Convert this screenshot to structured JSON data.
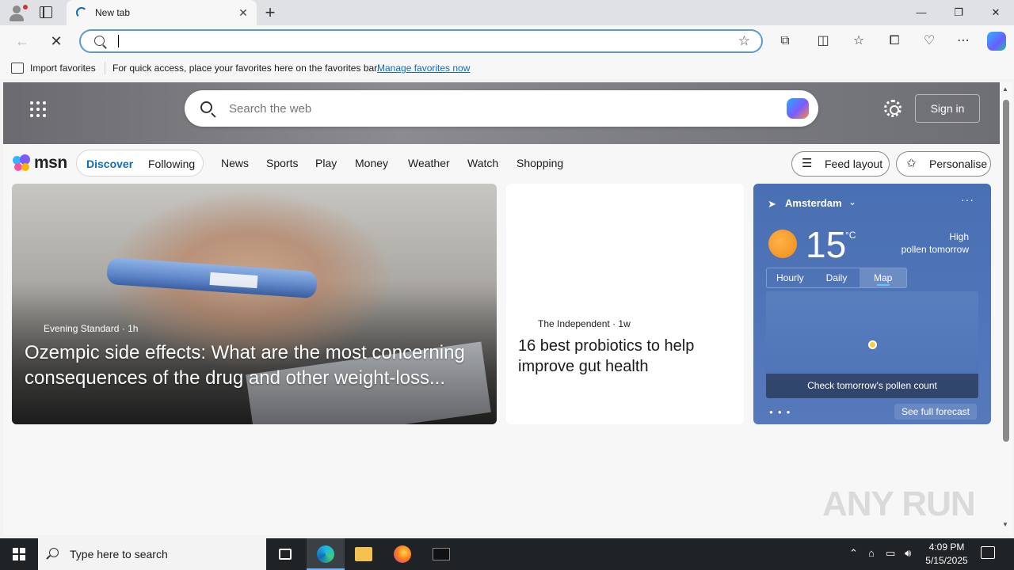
{
  "browser": {
    "tab": {
      "title": "New tab",
      "close": "✕"
    },
    "new_tab": "+",
    "window_controls": {
      "minimize": "—",
      "restore": "❐",
      "close": "✕"
    },
    "address": {
      "value": "",
      "placeholder": ""
    },
    "favorites_bar": {
      "import_label": "Import favorites",
      "message": "For quick access, place your favorites here on the favorites bar.",
      "manage_link": "Manage favorites now"
    },
    "toolbar_icons": [
      "extensions-icon",
      "split-screen-icon",
      "favorites-icon",
      "collections-icon",
      "browser-essentials-icon",
      "more-icon",
      "copilot-icon"
    ]
  },
  "msn": {
    "search_placeholder": "Search the web",
    "sign_in": "Sign in",
    "logo": "msn",
    "pill": {
      "discover": "Discover",
      "following": "Following"
    },
    "categories": [
      "News",
      "Sports",
      "Play",
      "Money",
      "Weather",
      "Watch",
      "Shopping"
    ],
    "feed_layout": "Feed layout",
    "personalise": "Personalise"
  },
  "cards": {
    "hero": {
      "source": "Evening Standard · 1h",
      "headline": "Ozempic side effects: What are the most concerning consequences of the drug and other weight-loss..."
    },
    "story": {
      "source": "The Independent · 1w",
      "headline": "16 best probiotics to help improve gut health"
    }
  },
  "weather": {
    "city": "Amsterdam",
    "temperature": "15",
    "unit": "°C",
    "alert_line1": "High",
    "alert_line2": "pollen tomorrow",
    "tabs": [
      "Hourly",
      "Daily",
      "Map"
    ],
    "active_tab": "Map",
    "map_cta": "Check tomorrow's pollen count",
    "see_full": "See full forecast",
    "more": "···",
    "dots": "●●●"
  },
  "watermark": "ANY RUN",
  "taskbar": {
    "search_placeholder": "Type here to search",
    "time": "4:09 PM",
    "date": "5/15/2025",
    "apps": [
      "task-view-icon",
      "edge-icon",
      "file-explorer-icon",
      "firefox-icon",
      "terminal-icon"
    ]
  },
  "colors": {
    "accent": "#0f6cbd",
    "omnibox_border": "#5b9bd5",
    "weather_bg": "#4f74b8",
    "taskbar": "#1f2326"
  }
}
